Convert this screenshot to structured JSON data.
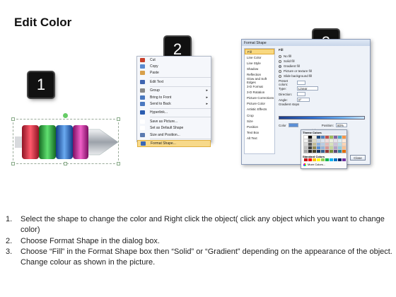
{
  "title": "Edit Color",
  "badges": [
    "1",
    "2",
    "3"
  ],
  "shape": {
    "colors": [
      "#d6263c",
      "#29a83a",
      "#2468c8",
      "#c61e9a",
      "#c9ccd0"
    ]
  },
  "context_menu": {
    "items": [
      {
        "label": "Cut",
        "icon_color": "#c8402a"
      },
      {
        "label": "Copy",
        "icon_color": "#5a8ad0"
      },
      {
        "label": "Paste",
        "icon_color": "#d8a04a"
      },
      {
        "label": "Edit Text",
        "icon_color": "#3e64b0"
      },
      {
        "label": "Group",
        "icon_color": "#888888",
        "arrow": "▸"
      },
      {
        "label": "Bring to Front",
        "icon_color": "#4a78c0",
        "arrow": "▸"
      },
      {
        "label": "Send to Back",
        "icon_color": "#4a78c0",
        "arrow": "▸"
      },
      {
        "label": "Hyperlink...",
        "icon_color": "#2a5cb0"
      },
      {
        "label": "Save as Picture...",
        "icon_color": "#ffffff"
      },
      {
        "label": "Set as Default Shape",
        "icon_color": "#ffffff"
      },
      {
        "label": "Size and Position...",
        "icon_color": "#5a7ab0"
      },
      {
        "label": "Format Shape...",
        "icon_color": "#3a68b8"
      }
    ]
  },
  "dialog": {
    "title": "Format Shape",
    "nav": [
      "Fill",
      "Line Color",
      "Line Style",
      "Shadow",
      "Reflection",
      "Glow and Soft Edges",
      "3-D Format",
      "3-D Rotation",
      "Picture Corrections",
      "Picture Color",
      "Artistic Effects",
      "Crop",
      "Size",
      "Position",
      "Text Box",
      "Alt Text"
    ],
    "fill_heading": "Fill",
    "fill_options": [
      "No fill",
      "Solid fill",
      "Gradient fill",
      "Picture or texture fill",
      "Slide background fill"
    ],
    "rows": [
      {
        "label": "Preset colors:",
        "value": ""
      },
      {
        "label": "Type:",
        "value": "Linear"
      },
      {
        "label": "Direction:",
        "value": ""
      },
      {
        "label": "Angle:",
        "value": "0°"
      }
    ],
    "gradient_stops": "Gradient stops",
    "color_label": "Color",
    "position_label": "Position:",
    "position_value": "80%",
    "brightness_label": "Brightness:",
    "transparency_label": "Transparency:",
    "rotate_label": "Rotate with shape",
    "close_label": "Close"
  },
  "palette": {
    "theme_heading": "Theme Colors",
    "standard_heading": "Standard Colors",
    "more_label": "More Colors...",
    "theme": [
      "#ffffff",
      "#000000",
      "#eeece1",
      "#1f497d",
      "#4f81bd",
      "#c0504d",
      "#9bbb59",
      "#8064a2",
      "#4bacc6",
      "#f79646",
      "#f2f2f2",
      "#7f7f7f",
      "#ddd9c3",
      "#c6d9f0",
      "#dbe5f1",
      "#f2dcdb",
      "#ebf1dd",
      "#e5e0ec",
      "#dbeef3",
      "#fdeada",
      "#d8d8d8",
      "#595959",
      "#c4bd97",
      "#8db3e2",
      "#b8cce4",
      "#e5b9b7",
      "#d7e3bc",
      "#ccc1d9",
      "#b7dde8",
      "#fbd5b5",
      "#bfbfbf",
      "#3f3f3f",
      "#938953",
      "#548dd4",
      "#95b3d7",
      "#d99694",
      "#c3d69b",
      "#b2a2c7",
      "#92cddc",
      "#fac08f",
      "#a5a5a5",
      "#262626",
      "#494429",
      "#17365d",
      "#366092",
      "#953734",
      "#76923c",
      "#5f497a",
      "#31859b",
      "#e36c09"
    ],
    "standard": [
      "#c00000",
      "#ff0000",
      "#ffc000",
      "#ffff00",
      "#92d050",
      "#00b050",
      "#00b0f0",
      "#0070c0",
      "#002060",
      "#7030a0"
    ]
  },
  "steps": [
    {
      "num": "1.",
      "text": "Select the shape to change the color and Right click the object( click any object which you want to change color)"
    },
    {
      "num": "2.",
      "text": "Choose Format Shape in the dialog box."
    },
    {
      "num": "3.",
      "text": "Choose “Fill” in the Format Shape box then “Solid” or “Gradient” depending on the appearance of the object. Change colour as shown in the picture."
    }
  ]
}
